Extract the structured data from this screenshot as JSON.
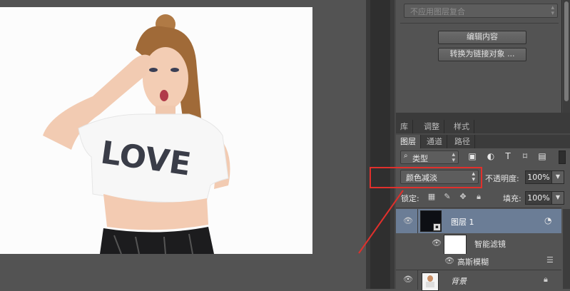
{
  "properties": {
    "layer_comp_select": "不应用图层复合",
    "edit_contents_button": "编辑内容",
    "convert_to_linked_button": "转换为链接对象 ..."
  },
  "panel_tabs_top": [
    "库",
    "调整",
    "样式"
  ],
  "panel_tabs_layers": [
    "图层",
    "通道",
    "路径"
  ],
  "layers_panel": {
    "filter_kind": "类型",
    "filter_icons": [
      "image-filter-icon",
      "adjustment-filter-icon",
      "type-filter-icon",
      "shape-filter-icon",
      "smart-object-filter-icon"
    ],
    "blend_mode": "颜色减淡",
    "opacity_label": "不透明度:",
    "opacity_value": "100%",
    "lock_label": "锁定:",
    "lock_icons": [
      "lock-transparent-icon",
      "lock-paint-icon",
      "lock-position-icon",
      "lock-all-icon"
    ],
    "fill_label": "填充:",
    "fill_value": "100%",
    "layers": [
      {
        "name": "图层 1",
        "selected": true
      },
      {
        "name": "智能滤镜"
      },
      {
        "name": "高斯模糊"
      },
      {
        "name": "背景"
      }
    ]
  },
  "canvas": {
    "shirt_text": "LOVE"
  },
  "colors": {
    "highlight_box": "#e0302c",
    "selected_layer": "#6b7d96",
    "panel_bg": "#535353"
  }
}
